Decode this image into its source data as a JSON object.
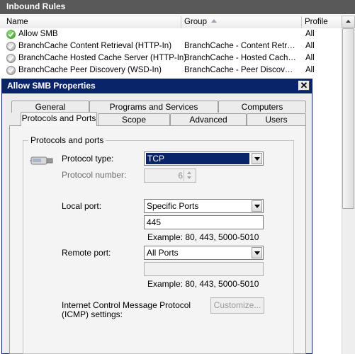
{
  "panel": {
    "title": "Inbound Rules"
  },
  "columns": {
    "name": "Name",
    "group": "Group",
    "profile": "Profile"
  },
  "rules": [
    {
      "name": "Allow SMB",
      "group": "",
      "profile": "All",
      "icon": "green-check-icon"
    },
    {
      "name": "BranchCache Content Retrieval (HTTP-In)",
      "group": "BranchCache - Content Retrie...",
      "profile": "All",
      "icon": "gray-check-icon"
    },
    {
      "name": "BranchCache Hosted Cache Server (HTTP-In)",
      "group": "BranchCache - Hosted Cache ...",
      "profile": "All",
      "icon": "gray-check-icon"
    },
    {
      "name": "BranchCache Peer Discovery (WSD-In)",
      "group": "BranchCache - Peer Discovery...",
      "profile": "All",
      "icon": "gray-check-icon"
    }
  ],
  "dialog": {
    "title": "Allow SMB Properties",
    "close": "✕",
    "tabs_row1": [
      "General",
      "Programs and Services",
      "Computers"
    ],
    "tabs_row2": [
      "Protocols and Ports",
      "Scope",
      "Advanced",
      "Users"
    ],
    "active_tab": "Protocols and Ports",
    "group_label": "Protocols and ports",
    "protocol_type_label": "Protocol type:",
    "protocol_type_value": "TCP",
    "protocol_number_label": "Protocol number:",
    "protocol_number_value": "6",
    "local_port_label": "Local port:",
    "local_port_value": "Specific Ports",
    "local_port_text": "445",
    "local_example": "Example: 80, 443, 5000-5010",
    "remote_port_label": "Remote port:",
    "remote_port_value": "All Ports",
    "remote_port_text": "",
    "remote_example": "Example: 80, 443, 5000-5010",
    "icmp_label_line1": "Internet Control Message Protocol",
    "icmp_label_line2": "(ICMP) settings:",
    "customize_button": "Customize..."
  },
  "colors": {
    "title_bar": "#0a246a",
    "pane_header": "#595959",
    "selected": "#0a246a",
    "check_green": "#2f8e1e"
  }
}
